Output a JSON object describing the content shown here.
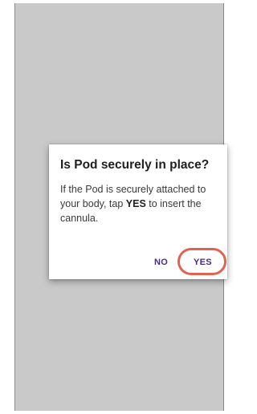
{
  "dialog": {
    "title": "Is Pod securely in place?",
    "body_before": "If the Pod is securely attached to your body, tap ",
    "body_emphasis": "YES",
    "body_after": " to insert the cannula.",
    "no_label": "NO",
    "yes_label": "YES"
  },
  "colors": {
    "screen_background": "#c9c9c9",
    "dialog_background": "#ffffff",
    "button_text": "#4a2b8c",
    "highlight_ring": "#e06352"
  }
}
